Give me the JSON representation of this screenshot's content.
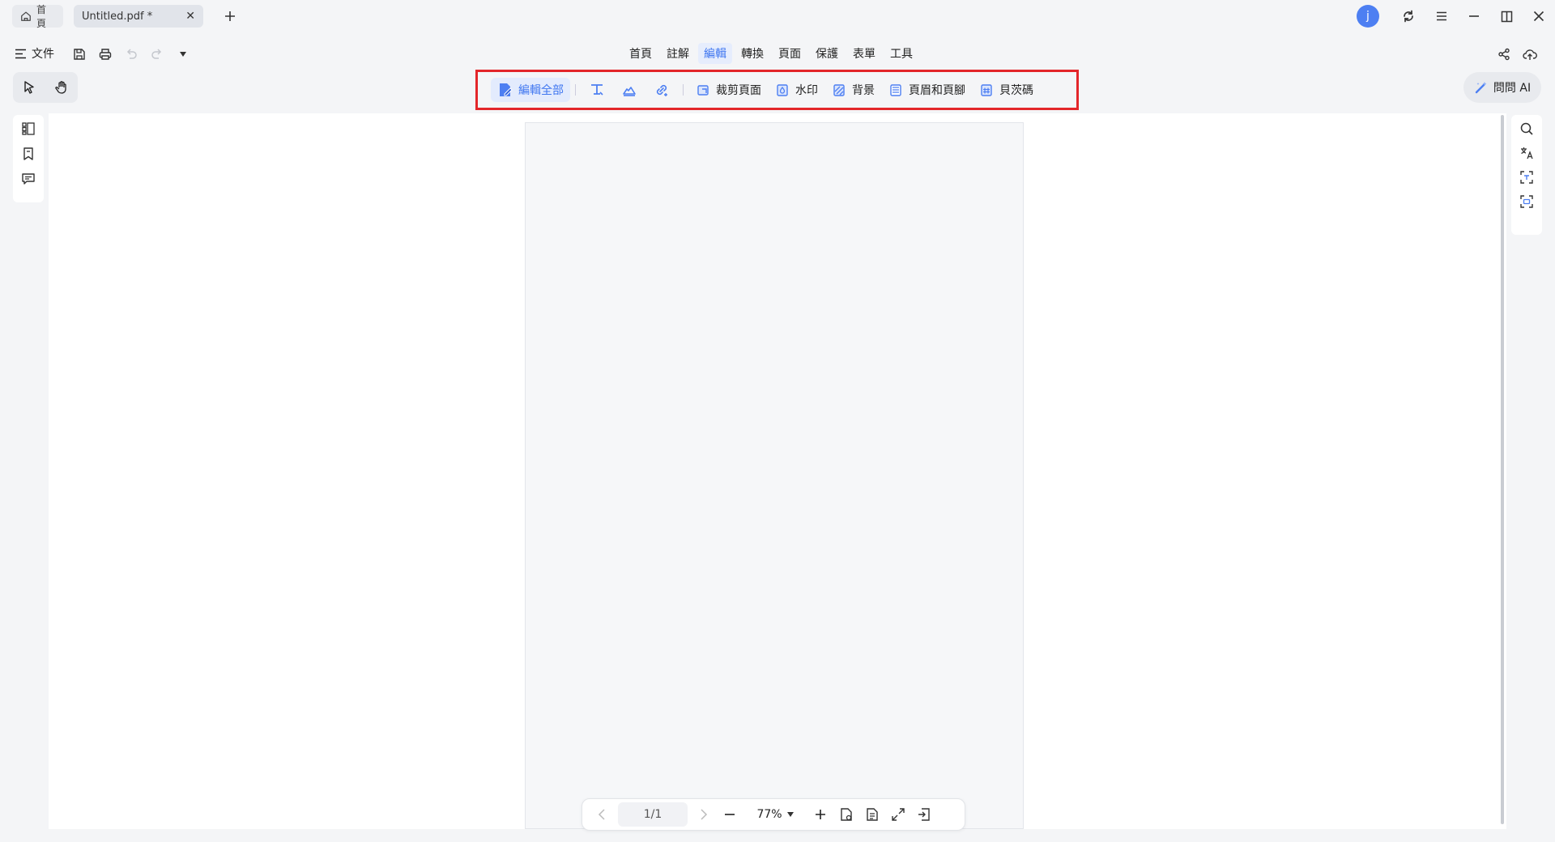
{
  "titlebar": {
    "home_tab": "首頁",
    "doc_tab": "Untitled.pdf *",
    "avatar_letter": "j"
  },
  "menu": {
    "file": "文件",
    "tabs": [
      "首頁",
      "註解",
      "編輯",
      "轉換",
      "頁面",
      "保護",
      "表單",
      "工具"
    ],
    "active_tab": "編輯"
  },
  "ribbon": {
    "edit_all": "編輯全部",
    "crop_page": "裁剪頁面",
    "watermark": "水印",
    "background": "背景",
    "header_footer": "頁眉和頁腳",
    "page_number": "貝茨碼"
  },
  "ask_ai": "問問 AI",
  "bottom_bar": {
    "page_indicator": "1/1",
    "zoom_level": "77%"
  },
  "colors": {
    "accent": "#3f76f0",
    "highlight_border": "#e3262a",
    "avatar": "#4d7ff2"
  }
}
